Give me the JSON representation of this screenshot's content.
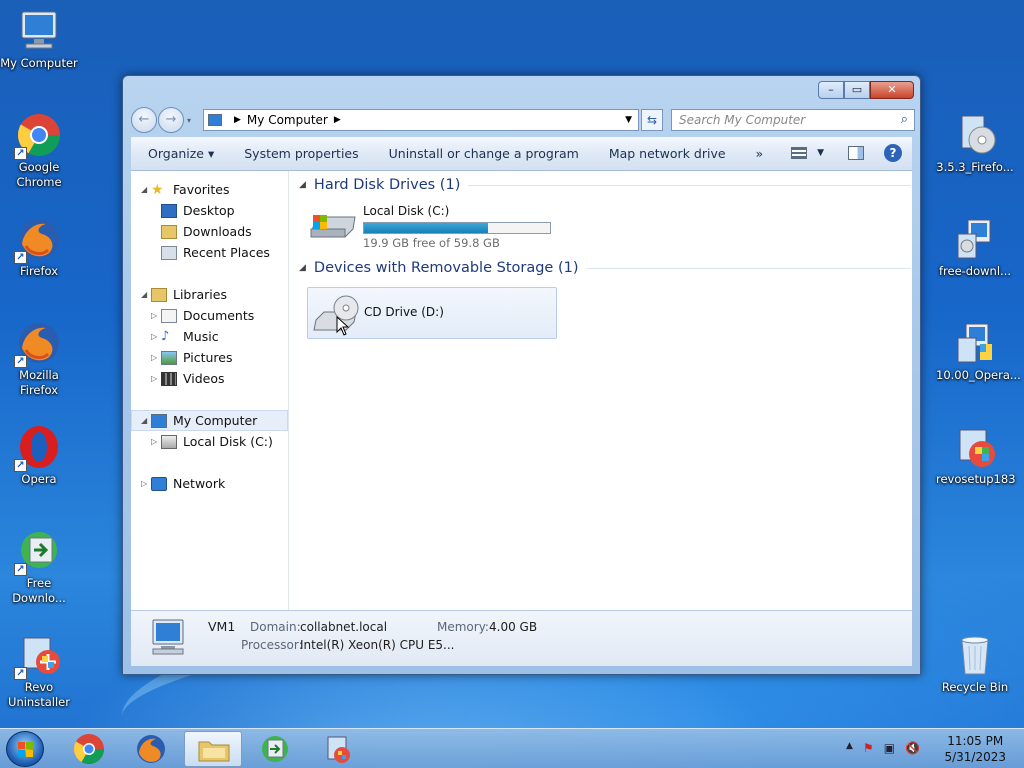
{
  "desktop": {
    "icons": [
      {
        "label": "My Computer",
        "icon": "computer-icon"
      },
      {
        "label": "Google Chrome",
        "icon": "chrome-icon"
      },
      {
        "label": "Firefox",
        "icon": "firefox-icon"
      },
      {
        "label": "Mozilla Firefox",
        "icon": "firefox-icon"
      },
      {
        "label": "Opera",
        "icon": "opera-icon"
      },
      {
        "label": "Free Downlo...",
        "icon": "download-manager-icon"
      },
      {
        "label": "Revo Uninstaller",
        "icon": "installer-icon"
      },
      {
        "label": "3.5.3_Firefo...",
        "icon": "installer-icon"
      },
      {
        "label": "free-downl...",
        "icon": "installer-icon"
      },
      {
        "label": "10.00_Opera...",
        "icon": "installer-icon"
      },
      {
        "label": "revosetup183",
        "icon": "installer-icon"
      },
      {
        "label": "Recycle Bin",
        "icon": "recycle-bin-icon"
      }
    ]
  },
  "window": {
    "address": {
      "path": "My Computer"
    },
    "search": {
      "placeholder": "Search My Computer"
    },
    "toolbar": {
      "organize": "Organize",
      "system_properties": "System properties",
      "uninstall": "Uninstall or change a program",
      "map_drive": "Map network drive",
      "more": "»"
    },
    "nav": {
      "favorites": "Favorites",
      "desktop": "Desktop",
      "downloads": "Downloads",
      "recent": "Recent Places",
      "libraries": "Libraries",
      "documents": "Documents",
      "music": "Music",
      "pictures": "Pictures",
      "videos": "Videos",
      "my_computer": "My Computer",
      "local_disk": "Local Disk (C:)",
      "network": "Network"
    },
    "groups": {
      "hdd": "Hard Disk Drives (1)",
      "removable": "Devices with Removable Storage (1)"
    },
    "drives": {
      "c_label": "Local Disk (C:)",
      "c_free": "19.9 GB free of 59.8 GB",
      "c_used_fraction": 0.667,
      "d_label": "CD Drive (D:)"
    },
    "details": {
      "name": "VM1",
      "domain_label": "Domain:",
      "domain": "collabnet.local",
      "memory_label": "Memory:",
      "memory": "4.00 GB",
      "processor_label": "Processor:",
      "processor": "Intel(R) Xeon(R) CPU E5..."
    }
  },
  "taskbar": {
    "time": "11:05 PM",
    "date": "5/31/2023"
  }
}
